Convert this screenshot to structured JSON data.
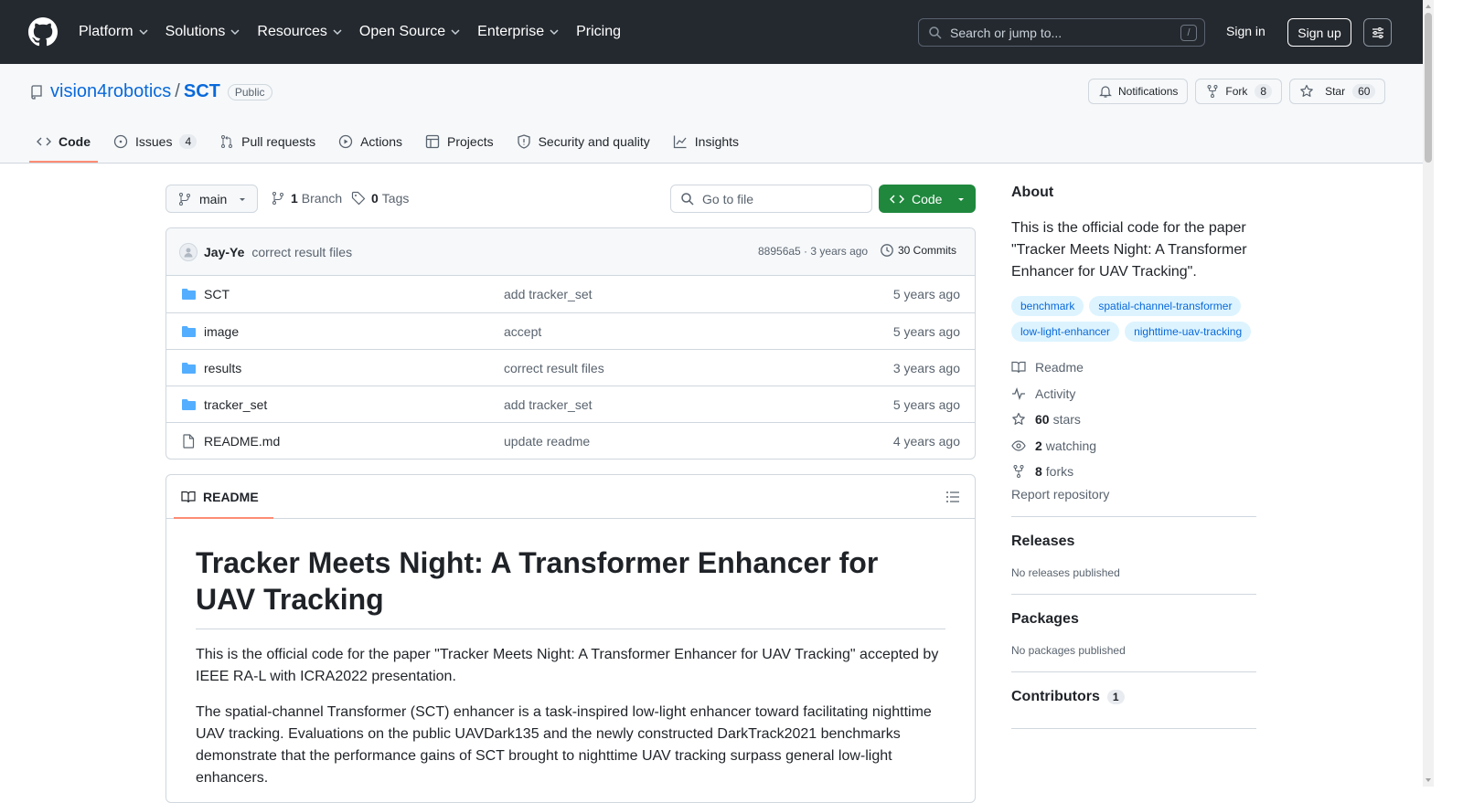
{
  "header": {
    "nav": [
      "Platform",
      "Solutions",
      "Resources",
      "Open Source",
      "Enterprise",
      "Pricing"
    ],
    "search_placeholder": "Search or jump to...",
    "search_shortcut": "/",
    "signin": "Sign in",
    "signup": "Sign up"
  },
  "repo": {
    "owner": "vision4robotics",
    "separator": "/",
    "name": "SCT",
    "visibility": "Public",
    "notifications": "Notifications",
    "fork_label": "Fork",
    "fork_count": "8",
    "star_label": "Star",
    "star_count": "60"
  },
  "tabs": [
    {
      "label": "Code",
      "icon": "code-icon"
    },
    {
      "label": "Issues",
      "icon": "issue-icon",
      "count": "4"
    },
    {
      "label": "Pull requests",
      "icon": "pull-request-icon"
    },
    {
      "label": "Actions",
      "icon": "play-icon"
    },
    {
      "label": "Projects",
      "icon": "table-icon"
    },
    {
      "label": "Security and quality",
      "icon": "shield-icon"
    },
    {
      "label": "Insights",
      "icon": "graph-icon"
    }
  ],
  "toolbar": {
    "branch": "main",
    "branches_count": "1",
    "branches_label": "Branch",
    "tags_count": "0",
    "tags_label": "Tags",
    "goto_placeholder": "Go to file",
    "code_label": "Code"
  },
  "commit": {
    "author": "Jay-Ye",
    "message": "correct result files",
    "meta": "88956a5 · 3 years ago",
    "commits_label": "30 Commits"
  },
  "files": [
    {
      "name": "SCT",
      "type": "folder",
      "message": "add tracker_set",
      "date": "5 years ago"
    },
    {
      "name": "image",
      "type": "folder",
      "message": "accept",
      "date": "5 years ago"
    },
    {
      "name": "results",
      "type": "folder",
      "message": "correct result files",
      "date": "3 years ago"
    },
    {
      "name": "tracker_set",
      "type": "folder",
      "message": "add tracker_set",
      "date": "5 years ago"
    },
    {
      "name": "README.md",
      "type": "file",
      "message": "update readme",
      "date": "4 years ago"
    }
  ],
  "readme": {
    "tab_label": "README",
    "title": "Tracker Meets Night: A Transformer Enhancer for UAV Tracking",
    "p1": "This is the official code for the paper \"Tracker Meets Night: A Transformer Enhancer for UAV Tracking\" accepted by IEEE RA-L with ICRA2022 presentation.",
    "p2": "The spatial-channel Transformer (SCT) enhancer is a task-inspired low-light enhancer toward facilitating nighttime UAV tracking. Evaluations on the public UAVDark135 and the newly constructed DarkTrack2021 benchmarks demonstrate that the performance gains of SCT brought to nighttime UAV tracking surpass general low-light enhancers."
  },
  "about": {
    "title": "About",
    "description": "This is the official code for the paper \"Tracker Meets Night: A Transformer Enhancer for UAV Tracking\".",
    "topics": [
      "benchmark",
      "spatial-channel-transformer",
      "low-light-enhancer",
      "nighttime-uav-tracking"
    ],
    "readme": "Readme",
    "activity": "Activity",
    "stars_count": "60",
    "stars_label": "stars",
    "watching_count": "2",
    "watching_label": "watching",
    "forks_count": "8",
    "forks_label": "forks",
    "report": "Report repository"
  },
  "releases": {
    "title": "Releases",
    "text": "No releases published"
  },
  "packages": {
    "title": "Packages",
    "text": "No packages published"
  },
  "contributors": {
    "title": "Contributors",
    "count": "1"
  },
  "colors": {
    "accent": "#0969da",
    "primary_button": "#1f883d",
    "header_bg": "#24292f",
    "tab_underline": "#fd8c73"
  }
}
